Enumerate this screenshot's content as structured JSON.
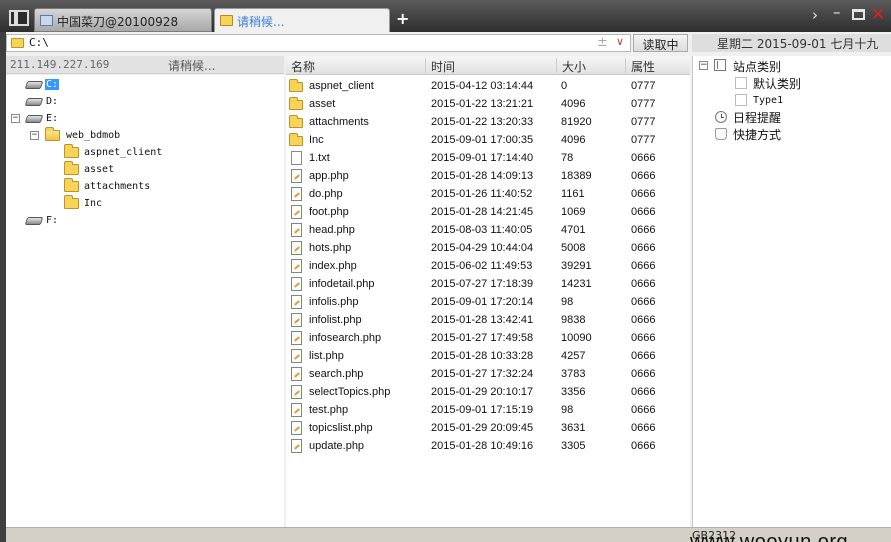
{
  "tabs": [
    {
      "label": "中国菜刀@20100928"
    },
    {
      "label": "请稍候..."
    }
  ],
  "new_tab_label": "+",
  "address": {
    "path": "C:\\"
  },
  "address_add": "±",
  "address_drop": "∨",
  "read_button": "读取中",
  "date_display": "星期二 2015-09-01 七月十九",
  "left_header": {
    "ip": "211.149.227.169",
    "status": "请稍候..."
  },
  "tree": {
    "drive_c": "C:",
    "drive_d": "D:",
    "drive_e": "E:",
    "web_bdmob": "web_bdmob",
    "aspnet_client": "aspnet_client",
    "asset": "asset",
    "attachments": "attachments",
    "inc": "Inc",
    "drive_f": "F:"
  },
  "columns": {
    "name": "名称",
    "time": "时间",
    "size": "大小",
    "attr": "属性"
  },
  "files": [
    {
      "name": "aspnet_client",
      "time": "2015-04-12 03:14:44",
      "size": "0",
      "attr": "0777"
    },
    {
      "name": "asset",
      "time": "2015-01-22 13:21:21",
      "size": "4096",
      "attr": "0777"
    },
    {
      "name": "attachments",
      "time": "2015-01-22 13:20:33",
      "size": "81920",
      "attr": "0777"
    },
    {
      "name": "Inc",
      "time": "2015-09-01 17:00:35",
      "size": "4096",
      "attr": "0777"
    },
    {
      "name": "1.txt",
      "time": "2015-09-01 17:14:40",
      "size": "78",
      "attr": "0666"
    },
    {
      "name": "app.php",
      "time": "2015-01-28 14:09:13",
      "size": "18389",
      "attr": "0666"
    },
    {
      "name": "do.php",
      "time": "2015-01-26 11:40:52",
      "size": "1161",
      "attr": "0666"
    },
    {
      "name": "foot.php",
      "time": "2015-01-28 14:21:45",
      "size": "1069",
      "attr": "0666"
    },
    {
      "name": "head.php",
      "time": "2015-08-03 11:40:05",
      "size": "4701",
      "attr": "0666"
    },
    {
      "name": "hots.php",
      "time": "2015-04-29 10:44:04",
      "size": "5008",
      "attr": "0666"
    },
    {
      "name": "index.php",
      "time": "2015-06-02 11:49:53",
      "size": "39291",
      "attr": "0666"
    },
    {
      "name": "infodetail.php",
      "time": "2015-07-27 17:18:39",
      "size": "14231",
      "attr": "0666"
    },
    {
      "name": "infolis.php",
      "time": "2015-09-01 17:20:14",
      "size": "98",
      "attr": "0666"
    },
    {
      "name": "infolist.php",
      "time": "2015-01-28 13:42:41",
      "size": "9838",
      "attr": "0666"
    },
    {
      "name": "infosearch.php",
      "time": "2015-01-27 17:49:58",
      "size": "10090",
      "attr": "0666"
    },
    {
      "name": "list.php",
      "time": "2015-01-28 10:33:28",
      "size": "4257",
      "attr": "0666"
    },
    {
      "name": "search.php",
      "time": "2015-01-27 17:32:24",
      "size": "3783",
      "attr": "0666"
    },
    {
      "name": "selectTopics.php",
      "time": "2015-01-29 20:10:17",
      "size": "3356",
      "attr": "0666"
    },
    {
      "name": "test.php",
      "time": "2015-09-01 17:15:19",
      "size": "98",
      "attr": "0666"
    },
    {
      "name": "topicslist.php",
      "time": "2015-01-29 20:09:45",
      "size": "3631",
      "attr": "0666"
    },
    {
      "name": "update.php",
      "time": "2015-01-28 10:49:16",
      "size": "3305",
      "attr": "0666"
    }
  ],
  "right_panel": {
    "site_category": "站点类别",
    "default_category": "默认类别",
    "type1": "Type1",
    "schedule": "日程提醒",
    "shortcuts": "快捷方式"
  },
  "status": {
    "encoding": "GB2312"
  },
  "watermark": "www.wooyun.org"
}
